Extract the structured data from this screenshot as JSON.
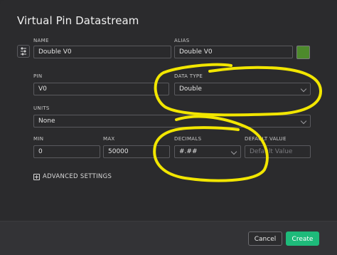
{
  "dialog": {
    "title": "Virtual Pin Datastream"
  },
  "fields": {
    "name": {
      "label": "NAME",
      "value": "Double V0"
    },
    "alias": {
      "label": "ALIAS",
      "value": "Double V0"
    },
    "pin": {
      "label": "PIN",
      "value": "V0"
    },
    "data_type": {
      "label": "DATA TYPE",
      "value": "Double"
    },
    "units": {
      "label": "UNITS",
      "value": "None"
    },
    "min": {
      "label": "MIN",
      "value": "0"
    },
    "max": {
      "label": "MAX",
      "value": "50000"
    },
    "decimals": {
      "label": "DECIMALS",
      "value": "#.##"
    },
    "default_value": {
      "label": "DEFAULT VALUE",
      "placeholder": "Default Value"
    }
  },
  "color_swatch": {
    "color": "#4d8a2c"
  },
  "advanced": {
    "label": "ADVANCED SETTINGS"
  },
  "footer": {
    "cancel_label": "Cancel",
    "create_label": "Create"
  },
  "annotation": {
    "color": "#f2e600"
  }
}
